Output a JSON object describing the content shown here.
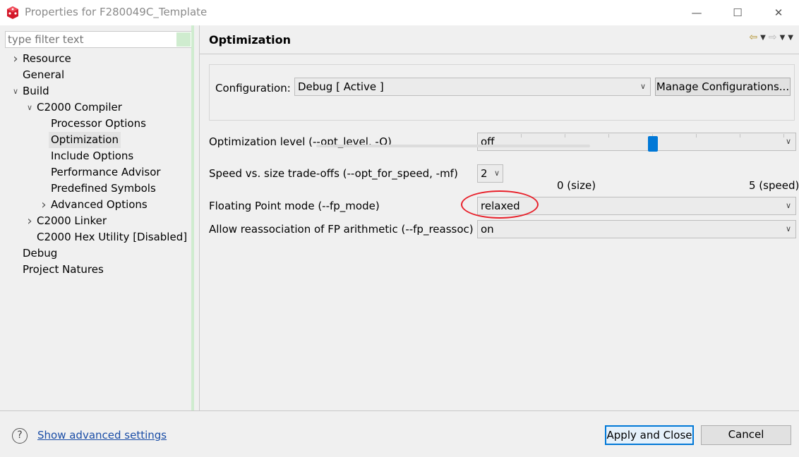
{
  "window": {
    "title": "Properties for F280049C_Template",
    "controls": {
      "minimize": "—",
      "maximize": "☐",
      "close": "✕"
    }
  },
  "sidebar": {
    "filter_placeholder": "type filter text",
    "items": [
      {
        "label": "Resource",
        "level": 0,
        "expander": "collapsed"
      },
      {
        "label": "General",
        "level": 0,
        "expander": "none"
      },
      {
        "label": "Build",
        "level": 0,
        "expander": "expanded"
      },
      {
        "label": "C2000 Compiler",
        "level": 1,
        "expander": "expanded"
      },
      {
        "label": "Processor Options",
        "level": 2,
        "expander": "none"
      },
      {
        "label": "Optimization",
        "level": 2,
        "expander": "none",
        "selected": true
      },
      {
        "label": "Include Options",
        "level": 2,
        "expander": "none"
      },
      {
        "label": "Performance Advisor",
        "level": 2,
        "expander": "none"
      },
      {
        "label": "Predefined Symbols",
        "level": 2,
        "expander": "none"
      },
      {
        "label": "Advanced Options",
        "level": 2,
        "expander": "collapsed"
      },
      {
        "label": "C2000 Linker",
        "level": 1,
        "expander": "collapsed"
      },
      {
        "label": "C2000 Hex Utility  [Disabled]",
        "level": 1,
        "expander": "none"
      },
      {
        "label": "Debug",
        "level": 0,
        "expander": "none"
      },
      {
        "label": "Project Natures",
        "level": 0,
        "expander": "none"
      }
    ]
  },
  "main": {
    "title": "Optimization",
    "configuration": {
      "label": "Configuration:",
      "value": "Debug  [ Active ]",
      "manage_button": "Manage Configurations..."
    },
    "optimization_level": {
      "label": "Optimization level (--opt_level, -O)",
      "value": "off"
    },
    "speed_vs_size": {
      "label": "Speed vs. size trade-offs (--opt_for_speed, -mf)",
      "value": "2",
      "min_label": "0 (size)",
      "max_label": "5 (speed)",
      "slider_fraction": 0.5
    },
    "fp_mode": {
      "label": "Floating Point mode (--fp_mode)",
      "value": "relaxed"
    },
    "fp_reassoc": {
      "label": "Allow reassociation of FP arithmetic (--fp_reassoc)",
      "value": "on"
    }
  },
  "footer": {
    "help_icon": "?",
    "advanced_link": "Show advanced settings",
    "apply_button": "Apply and Close",
    "cancel_button": "Cancel"
  },
  "colors": {
    "accent": "#0078d7",
    "highlight_ellipse": "#e8202a",
    "link": "#1a4da6"
  }
}
